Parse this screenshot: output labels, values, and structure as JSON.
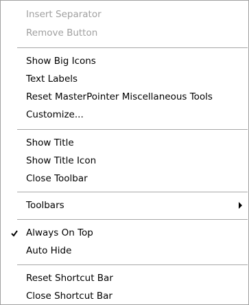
{
  "menu": {
    "insert_separator": "Insert Separator",
    "remove_button": "Remove Button",
    "show_big_icons": "Show Big Icons",
    "text_labels": "Text Labels",
    "reset_tools": "Reset MasterPointer Miscellaneous Tools",
    "customize": "Customize...",
    "show_title": "Show Title",
    "show_title_icon": "Show Title Icon",
    "close_toolbar": "Close Toolbar",
    "toolbars": "Toolbars",
    "always_on_top": "Always On Top",
    "always_on_top_checked": true,
    "auto_hide": "Auto Hide",
    "reset_shortcut_bar": "Reset Shortcut Bar",
    "close_shortcut_bar": "Close Shortcut Bar"
  },
  "colors": {
    "disabled_text": "#a0a0a0",
    "separator": "#a6a6a6",
    "border": "#a0a0a0"
  }
}
